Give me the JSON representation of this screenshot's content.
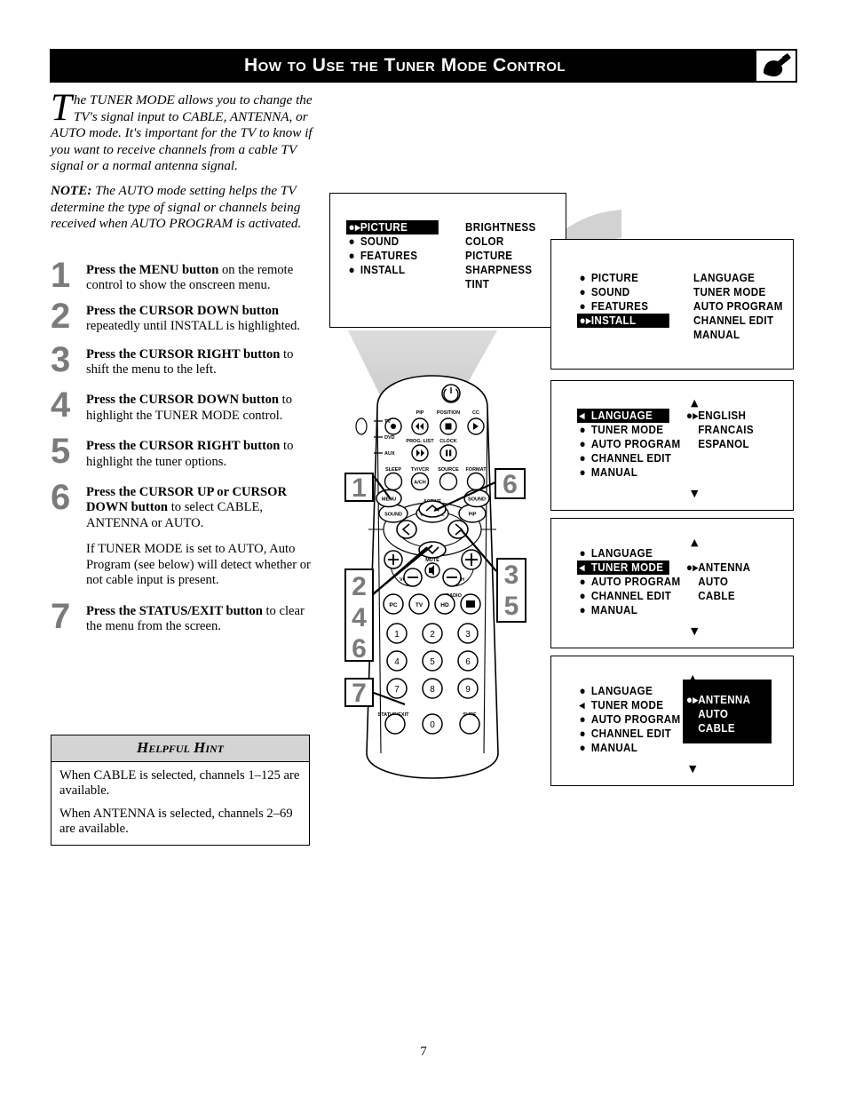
{
  "header": {
    "title": "How to Use the Tuner Mode Control",
    "logo_icon": "remote-cursor-logo-icon"
  },
  "intro": {
    "dropcap": "T",
    "paragraph_1": "he TUNER MODE allows you to change the TV's signal input to CABLE, ANTENNA, or AUTO mode. It's important for the TV to know if you want to receive channels from a cable TV signal or a normal antenna signal.",
    "note_label": "NOTE:",
    "note_text": " The AUTO mode setting helps the TV determine the type of signal or channels being received when AUTO PROGRAM is activated."
  },
  "steps": [
    {
      "num": "1",
      "bold": "Press the MENU button",
      "rest": " on the remote control to show the onscreen menu."
    },
    {
      "num": "2",
      "bold": "Press the CURSOR DOWN button",
      "rest": " repeatedly until INSTALL is highlighted."
    },
    {
      "num": "3",
      "bold": "Press the CURSOR RIGHT button",
      "rest": " to shift the menu to the left."
    },
    {
      "num": "4",
      "bold": "Press the CURSOR DOWN button",
      "rest": " to highlight the TUNER MODE control."
    },
    {
      "num": "5",
      "bold": "Press the CURSOR RIGHT button",
      "rest": " to highlight the tuner options."
    },
    {
      "num": "6",
      "bold": "Press the CURSOR UP or CURSOR DOWN button",
      "rest": " to select CABLE, ANTENNA or AUTO.",
      "extra": "If TUNER MODE is set to AUTO, Auto Program (see below) will detect whether or not cable input is present."
    },
    {
      "num": "7",
      "bold": "Press the STATUS/EXIT button",
      "rest": " to clear the menu from the screen."
    }
  ],
  "hint": {
    "title": "Helpful Hint",
    "line_1": "When CABLE is selected, channels 1–125 are available.",
    "line_2": "When ANTENNA is selected, channels 2–69 are available."
  },
  "screens": {
    "screen_1": {
      "left_items": [
        {
          "label": "PICTURE",
          "highlighted": true
        },
        {
          "label": "SOUND",
          "highlighted": false
        },
        {
          "label": "FEATURES",
          "highlighted": false
        },
        {
          "label": "INSTALL",
          "highlighted": false
        }
      ],
      "right_items": [
        "BRIGHTNESS",
        "COLOR",
        "PICTURE",
        "SHARPNESS",
        "TINT"
      ]
    },
    "screen_2": {
      "left_items": [
        {
          "label": "PICTURE",
          "highlighted": false
        },
        {
          "label": "SOUND",
          "highlighted": false
        },
        {
          "label": "FEATURES",
          "highlighted": false
        },
        {
          "label": "INSTALL",
          "highlighted": true
        }
      ],
      "right_items": [
        "LANGUAGE",
        "TUNER MODE",
        "AUTO PROGRAM",
        "CHANNEL EDIT",
        "MANUAL"
      ]
    },
    "screen_3": {
      "left_items": [
        {
          "label": "LANGUAGE",
          "highlighted": true
        },
        {
          "label": "TUNER MODE",
          "highlighted": false
        },
        {
          "label": "AUTO PROGRAM",
          "highlighted": false
        },
        {
          "label": "CHANNEL EDIT",
          "highlighted": false
        },
        {
          "label": "MANUAL",
          "highlighted": false
        }
      ],
      "options": [
        "ENGLISH",
        "FRANCAIS",
        "ESPANOL"
      ],
      "selected_option": "ENGLISH",
      "scroll_up": "▲",
      "scroll_down": "▼"
    },
    "screen_4": {
      "left_items": [
        {
          "label": "LANGUAGE",
          "highlighted": false
        },
        {
          "label": "TUNER MODE",
          "highlighted": true
        },
        {
          "label": "AUTO PROGRAM",
          "highlighted": false
        },
        {
          "label": "CHANNEL EDIT",
          "highlighted": false
        },
        {
          "label": "MANUAL",
          "highlighted": false
        }
      ],
      "options": [
        "ANTENNA",
        "AUTO",
        "CABLE"
      ],
      "selected_option": "ANTENNA",
      "scroll_up": "▲",
      "scroll_down": "▼"
    },
    "screen_5": {
      "left_items": [
        {
          "label": "LANGUAGE",
          "highlighted": false
        },
        {
          "label": "TUNER MODE",
          "highlighted": false
        },
        {
          "label": "AUTO PROGRAM",
          "highlighted": false
        },
        {
          "label": "CHANNEL EDIT",
          "highlighted": false
        },
        {
          "label": "MANUAL",
          "highlighted": false
        }
      ],
      "options": [
        "ANTENNA",
        "AUTO",
        "CABLE"
      ],
      "selected_option": "ANTENNA",
      "options_block_highlighted": true,
      "scroll_up": "▲",
      "scroll_down": "▼"
    }
  },
  "remote": {
    "mode_labels": [
      "TV",
      "DVD",
      "AUX"
    ],
    "top_labels": [
      "PIP",
      "POSITION",
      "CC"
    ],
    "mid_labels": [
      "PROG. LIST",
      "CLOCK"
    ],
    "row_labels": [
      "SLEEP",
      "TV/VCR",
      "SOURCE",
      "FORMAT"
    ],
    "aspect_label": "A/CH",
    "feature_labels": [
      "AUTO SOUND",
      "ACTIVE CONTROL",
      "PIP"
    ],
    "menu_button": "MENU",
    "sound_button": "SOUND",
    "volume_label": "VOL.",
    "channel_label": "CH",
    "mute_label": "MUTE",
    "source_buttons": [
      "PC",
      "TV",
      "HD"
    ],
    "radio_label": "RADIO",
    "keypad": [
      "1",
      "2",
      "3",
      "4",
      "5",
      "6",
      "7",
      "8",
      "9",
      "0"
    ],
    "status_exit_label": "STATUS/EXIT",
    "surf_label": "SURF",
    "power_icon": "power-icon"
  },
  "callouts": {
    "menu": [
      "1"
    ],
    "cursor_up": [
      "6"
    ],
    "cursor_down": [
      "2",
      "4",
      "6"
    ],
    "cursor_right": [
      "3",
      "5"
    ],
    "status_exit": [
      "7"
    ]
  },
  "page_number": "7",
  "colors": {
    "callout_number": "#7b7b7b",
    "hint_header": "#d4d4d4",
    "beam_gray": "#d2d2d2",
    "header_bg": "#000000"
  }
}
